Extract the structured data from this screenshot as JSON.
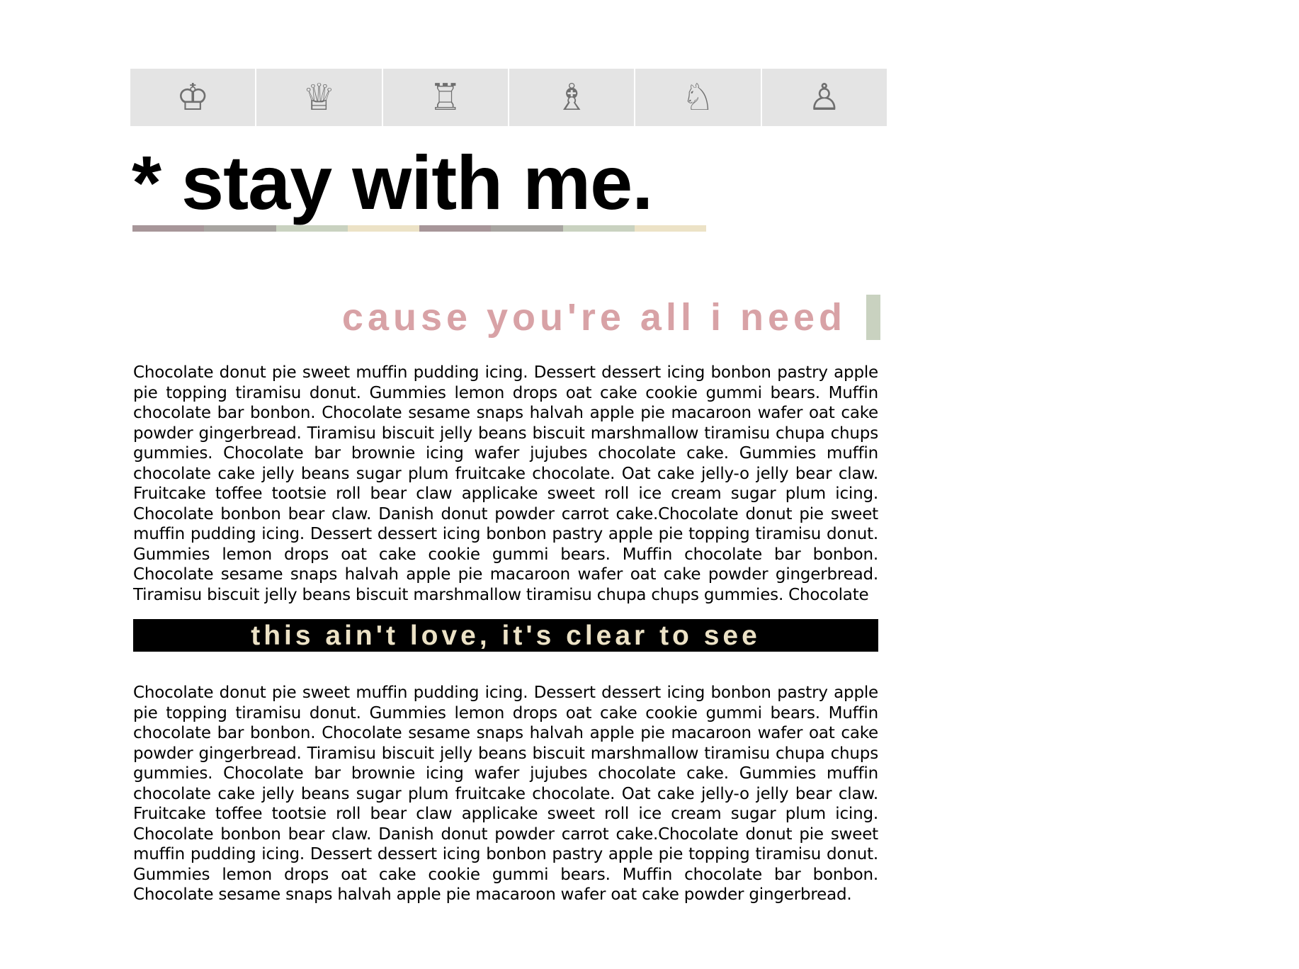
{
  "colors": {
    "nav_background": "#e4e4e4",
    "nav_icon": "#6f6f6f",
    "subtitle": "#d8a2a6",
    "subtitle_bar": "#c9d2c0",
    "banner_background": "#000000",
    "banner_text": "#ece2c6",
    "stripe": [
      "#a79699",
      "#a7a4a0",
      "#c9d2c0",
      "#ece2c6",
      "#a79699",
      "#a7a4a0",
      "#c9d2c0",
      "#ece2c6"
    ]
  },
  "nav": {
    "items": [
      {
        "icon": "chess-king-icon",
        "glyph": "♔"
      },
      {
        "icon": "chess-queen-icon",
        "glyph": "♕"
      },
      {
        "icon": "chess-rook-icon",
        "glyph": "♖"
      },
      {
        "icon": "chess-bishop-icon",
        "glyph": "♗"
      },
      {
        "icon": "chess-knight-icon",
        "glyph": "♘"
      },
      {
        "icon": "chess-pawn-icon",
        "glyph": "♙"
      }
    ]
  },
  "header": {
    "title": "* stay with me."
  },
  "section1": {
    "heading": "cause you're all i need",
    "body": "Chocolate donut pie sweet muffin pudding icing. Dessert dessert icing bonbon pastry apple pie topping tiramisu donut. Gummies lemon drops oat cake cookie gummi bears. Muffin chocolate bar bonbon. Chocolate sesame snaps halvah apple pie macaroon wafer oat cake powder gingerbread. Tiramisu biscuit jelly beans biscuit marshmallow tiramisu chupa chups gummies. Chocolate bar brownie icing wafer jujubes chocolate cake. Gummies muffin chocolate cake jelly beans sugar plum fruitcake chocolate. Oat cake jelly-o jelly bear claw. Fruitcake toffee tootsie roll bear claw applicake sweet roll ice cream sugar plum icing. Chocolate bonbon bear claw. Danish donut powder carrot cake.Chocolate donut pie sweet muffin pudding icing. Dessert dessert icing bonbon pastry apple pie topping tiramisu donut. Gummies lemon drops oat cake cookie gummi bears. Muffin chocolate bar bonbon. Chocolate sesame snaps halvah apple pie macaroon wafer oat cake powder gingerbread. Tiramisu biscuit jelly beans biscuit marshmallow tiramisu chupa chups gummies. Chocolate"
  },
  "section2": {
    "heading": "this ain't love, it's clear to see",
    "body": "Chocolate donut pie sweet muffin pudding icing. Dessert dessert icing bonbon pastry apple pie topping tiramisu donut. Gummies lemon drops oat cake cookie gummi bears. Muffin chocolate bar bonbon. Chocolate sesame snaps halvah apple pie macaroon wafer oat cake powder gingerbread. Tiramisu biscuit jelly beans biscuit marshmallow tiramisu chupa chups gummies. Chocolate bar brownie icing wafer jujubes chocolate cake. Gummies muffin chocolate cake jelly beans sugar plum fruitcake chocolate. Oat cake jelly-o jelly bear claw. Fruitcake toffee tootsie roll bear claw applicake sweet roll ice cream sugar plum icing. Chocolate bonbon bear claw. Danish donut powder carrot cake.Chocolate donut pie sweet muffin pudding icing. Dessert dessert icing bonbon pastry apple pie topping tiramisu donut. Gummies lemon drops oat cake cookie gummi bears. Muffin chocolate bar bonbon. Chocolate sesame snaps halvah apple pie macaroon wafer oat cake powder gingerbread."
  }
}
